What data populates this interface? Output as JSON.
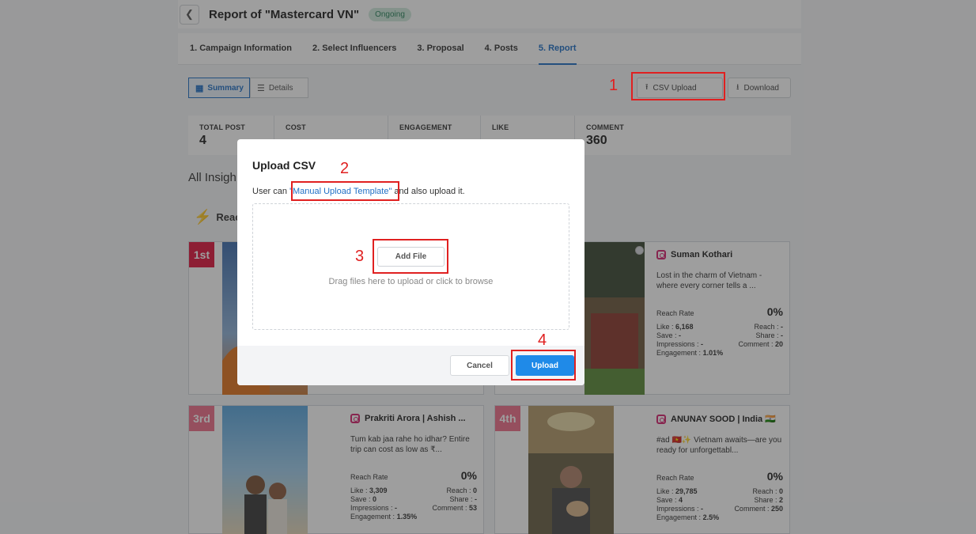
{
  "header": {
    "back_icon": "chevron-left-icon",
    "title": "Report of \"Mastercard VN\"",
    "status": "Ongoing",
    "status_color": "#27825a"
  },
  "tabs": [
    {
      "label": "1. Campaign Information"
    },
    {
      "label": "2. Select Influencers"
    },
    {
      "label": "3. Proposal"
    },
    {
      "label": "4. Posts"
    },
    {
      "label": "5. Report",
      "active": true
    }
  ],
  "toolbar": {
    "summary_label": "Summary",
    "details_label": "Details",
    "csv_upload_label": "CSV Upload",
    "download_label": "Download"
  },
  "stats": [
    {
      "label": "TOTAL POST",
      "value": "4"
    },
    {
      "label": "COST",
      "value": ""
    },
    {
      "label": "ENGAGEMENT",
      "value": ""
    },
    {
      "label": "LIKE",
      "value": ""
    },
    {
      "label": "COMMENT",
      "value": "360"
    }
  ],
  "section_title": "All Insigh",
  "reach_label": "Reac",
  "cards": [
    {
      "rank": "1st",
      "rank_color": "#e0163e",
      "account": "",
      "caption": "",
      "reach_rate_label": "",
      "reach_rate": ""
    },
    {
      "rank": "",
      "account": "Suman Kothari",
      "caption": "Lost in the charm of Vietnam - where every corner tells a ...",
      "reach_rate_label": "Reach Rate",
      "reach_rate": "0%",
      "like": "6,168",
      "reach": "-",
      "save": "-",
      "share": "-",
      "impressions": "-",
      "comment": "20",
      "engagement": "1.01%"
    },
    {
      "rank": "3rd",
      "rank_color": "#ee6f8a",
      "account": "Prakriti Arora | Ashish ...",
      "caption": "Tum kab jaa rahe ho idhar? Entire trip can cost as low as ₹...",
      "reach_rate_label": "Reach Rate",
      "reach_rate": "0%",
      "like": "3,309",
      "reach": "0",
      "save": "0",
      "share": "-",
      "impressions": "-",
      "comment": "53",
      "engagement": "1.35%"
    },
    {
      "rank": "4th",
      "rank_color": "#ee6f8a",
      "account": "ANUNAY SOOD | India 🇮🇳",
      "caption": "#ad 🇻🇳✨ Vietnam awaits—are you ready for unforgettabl...",
      "reach_rate_label": "Reach Rate",
      "reach_rate": "0%",
      "like": "29,785",
      "reach": "0",
      "save": "4",
      "share": "2",
      "impressions": "-",
      "comment": "250",
      "engagement": "2.5%"
    }
  ],
  "metric_labels": {
    "like": "Like :",
    "reach": "Reach :",
    "save": "Save :",
    "share": "Share :",
    "impressions": "Impressions :",
    "comment": "Comment :",
    "engagement": "Engagement :"
  },
  "modal": {
    "title": "Upload CSV",
    "desc_prefix": "User can ",
    "template_link": "\"Manual Upload Template\"",
    "desc_suffix": " and also upload it.",
    "add_file_label": "Add File",
    "drag_hint": "Drag files here to upload or click to browse",
    "cancel_label": "Cancel",
    "upload_label": "Upload",
    "upload_color": "#1f8ae8"
  },
  "annotations": [
    "1",
    "2",
    "3",
    "4"
  ]
}
